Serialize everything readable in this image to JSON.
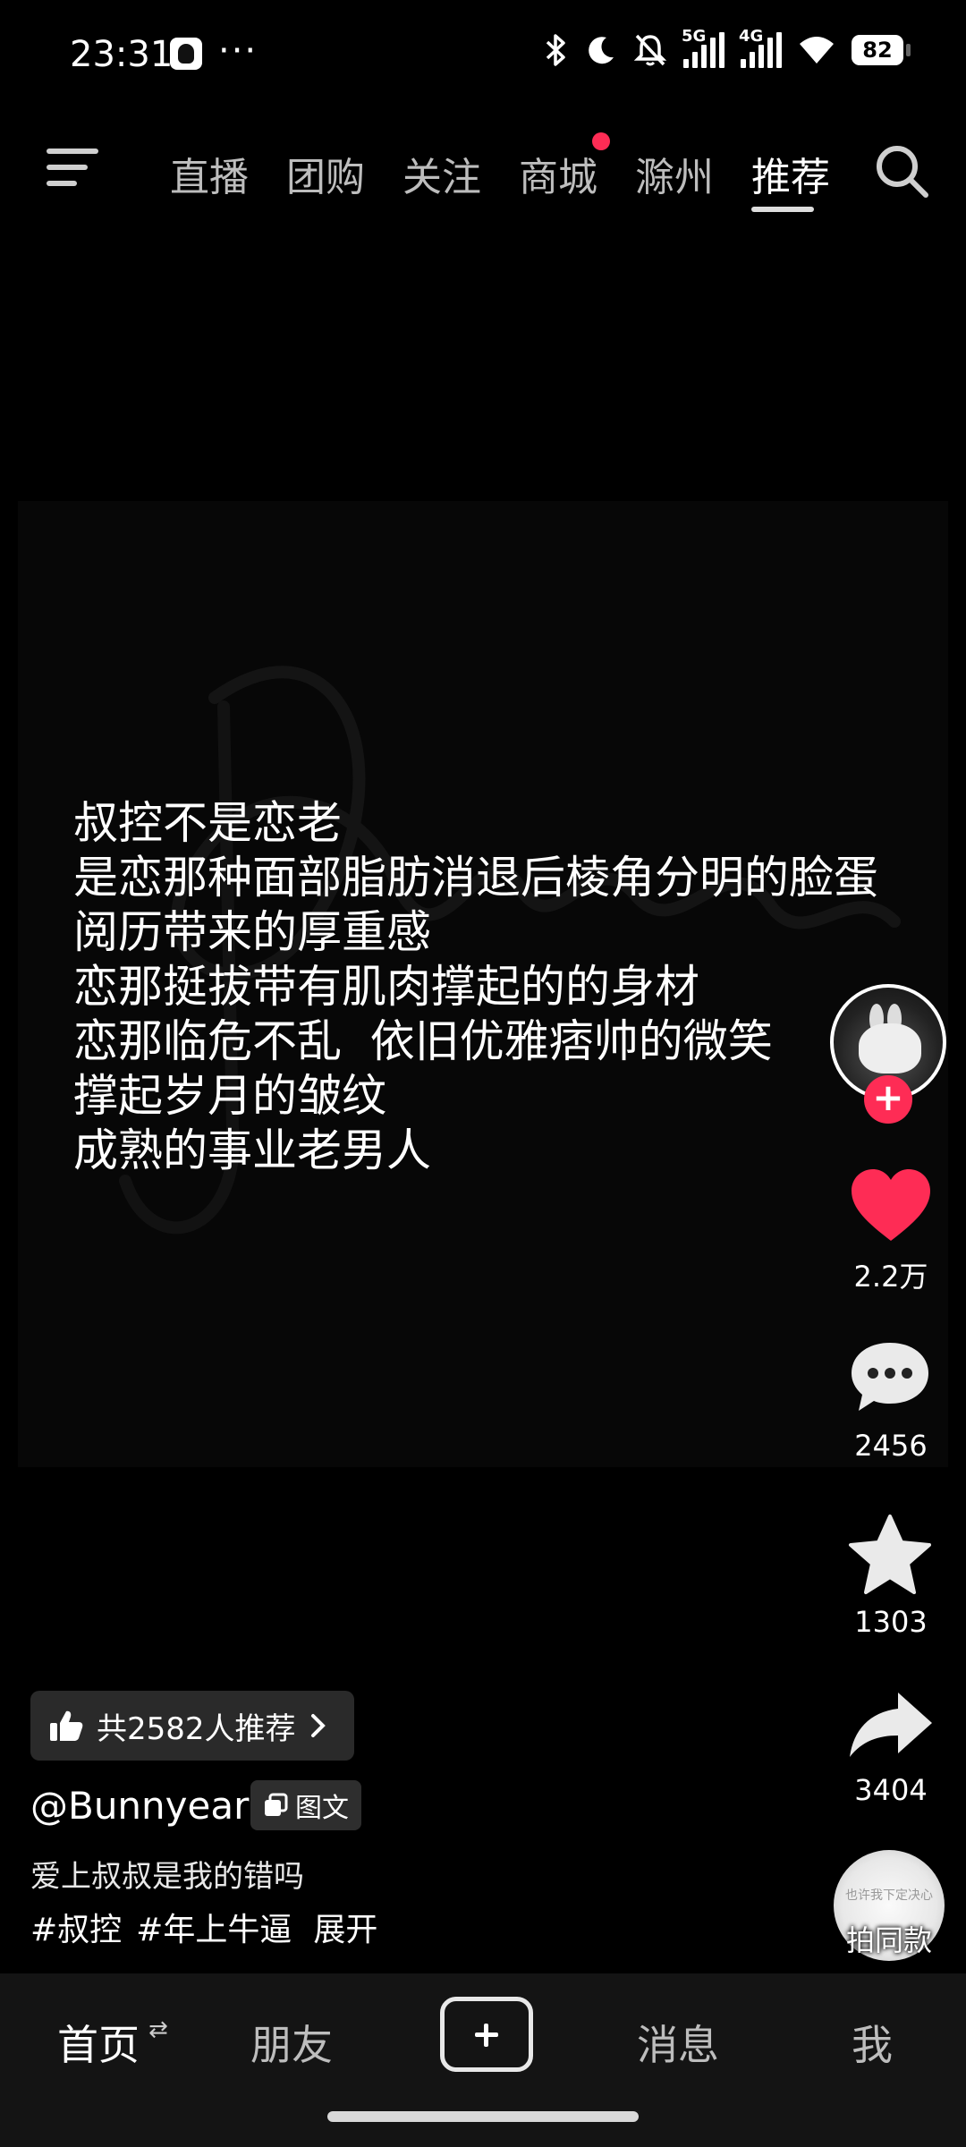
{
  "status_bar": {
    "time": "23:31",
    "more": "···",
    "network_5g": "5G",
    "network_4g": "4G",
    "battery": "82",
    "icons": [
      "qq-icon",
      "bluetooth-icon",
      "moon-icon",
      "bell-off-icon",
      "signal-5g-icon",
      "signal-4g-icon",
      "wifi-icon",
      "battery-icon"
    ]
  },
  "top_nav": {
    "tabs": [
      {
        "label": "直播"
      },
      {
        "label": "团购"
      },
      {
        "label": "关注"
      },
      {
        "label": "商城",
        "badge_dot": true
      },
      {
        "label": "滁州"
      },
      {
        "label": "推荐",
        "active": true
      }
    ]
  },
  "post": {
    "lines": [
      "叔控不是恋老",
      "是恋那种面部脂肪消退后棱角分明的脸蛋",
      "阅历带来的厚重感",
      "恋那挺拔带有肌肉撑起的的身材",
      "恋那临危不乱  依旧优雅痞帅的微笑",
      "撑起岁月的皱纹",
      "成熟的事业老男人"
    ]
  },
  "sidebar": {
    "follow": "+",
    "likes": "2.2万",
    "comments": "2456",
    "favorites": "1303",
    "shares": "3404",
    "music_label": "拍同款",
    "disc_text": "也许我下定决心"
  },
  "info": {
    "recommend": "共2582人推荐",
    "author": "@Bunnyear",
    "badge": "图文",
    "caption": "爱上叔叔是我的错吗",
    "tags": [
      "#叔控",
      "#年上牛逼"
    ],
    "expand": "展开"
  },
  "bottom_nav": {
    "home": "首页",
    "home_arrows": "⇄",
    "friends": "朋友",
    "messages": "消息",
    "me": "我"
  },
  "colors": {
    "accent": "#fe2c55",
    "background": "#000000",
    "nav_background": "#141414"
  }
}
